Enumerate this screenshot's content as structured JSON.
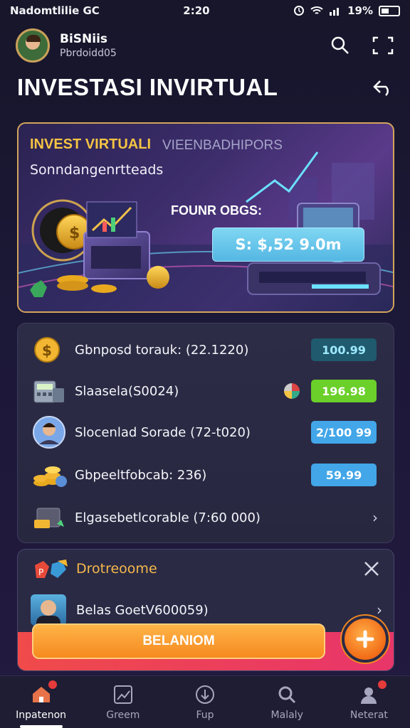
{
  "status_bar": {
    "left_text": "Nadomtlilie  GC",
    "time": "2:20",
    "battery": "19%"
  },
  "header": {
    "user_name": "BiSNiis",
    "user_sub": "Pbrdoidd05"
  },
  "page_title": "INVESTASI INVIRTUAL",
  "hero": {
    "title": "INVEST VIRTUALI",
    "title_secondary": "VIEENBADHIPORS",
    "subtitle": "Sonndangenrtteads",
    "label": "FOUNR OBGS:",
    "amount": "S: $,52 9.0m"
  },
  "list": {
    "items": [
      {
        "label": "Gbnposd torauk: (22.1220)",
        "value": "100.99",
        "style": "teal",
        "icon": "gold-coin-icon"
      },
      {
        "label": "Slaasela(S0024)",
        "value": "196.98",
        "style": "green",
        "icon": "calculator-icon"
      },
      {
        "label": "Slocenlad Sorade (72-t020)",
        "value": "2/100 99",
        "style": "blue",
        "icon": "person-avatar-icon"
      },
      {
        "label": "Gbpeeltfobcab: 236)",
        "value": "59.99",
        "style": "blue",
        "icon": "coin-stack-icon"
      },
      {
        "label": "Elgasebetlcorable (7:60 000)",
        "value": "",
        "style": "",
        "icon": "cash-box-icon"
      }
    ]
  },
  "notification": {
    "title": "Drotreoome",
    "row_label": "Belas GoetV600059)",
    "cta_label": "BELANIOM"
  },
  "bottom_nav": [
    {
      "label": "Inpatenon",
      "icon": "home-icon"
    },
    {
      "label": "Greem",
      "icon": "chart-icon"
    },
    {
      "label": "Fup",
      "icon": "download-icon"
    },
    {
      "label": "Malaly",
      "icon": "search-icon"
    },
    {
      "label": "Neterat",
      "icon": "profile-icon"
    }
  ]
}
